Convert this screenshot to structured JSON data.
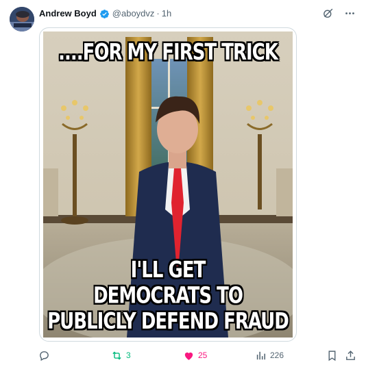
{
  "post": {
    "author": {
      "display_name": "Andrew Boyd",
      "handle": "@aboydvz",
      "verified": true,
      "verified_color": "#1d9bf0"
    },
    "separator": "·",
    "timestamp": "1h",
    "media": {
      "top_text": "....FOR MY FIRST TRICK",
      "bottom_text_lines": [
        "I'LL GET",
        "DEMOCRATS TO",
        "PUBLICLY DEFEND FRAUD"
      ]
    },
    "metrics": {
      "replies": "",
      "reposts": "3",
      "likes": "25",
      "views": "226"
    },
    "colors": {
      "repost_active": "#00ba7c",
      "like_active": "#f91880",
      "secondary_text": "#536471"
    },
    "icons": {
      "verified": "verified-badge-icon",
      "grok": "grok-icon",
      "more": "more-icon",
      "reply": "reply-icon",
      "repost": "repost-icon",
      "like": "heart-icon",
      "views": "views-icon",
      "bookmark": "bookmark-icon",
      "share": "share-icon"
    }
  }
}
